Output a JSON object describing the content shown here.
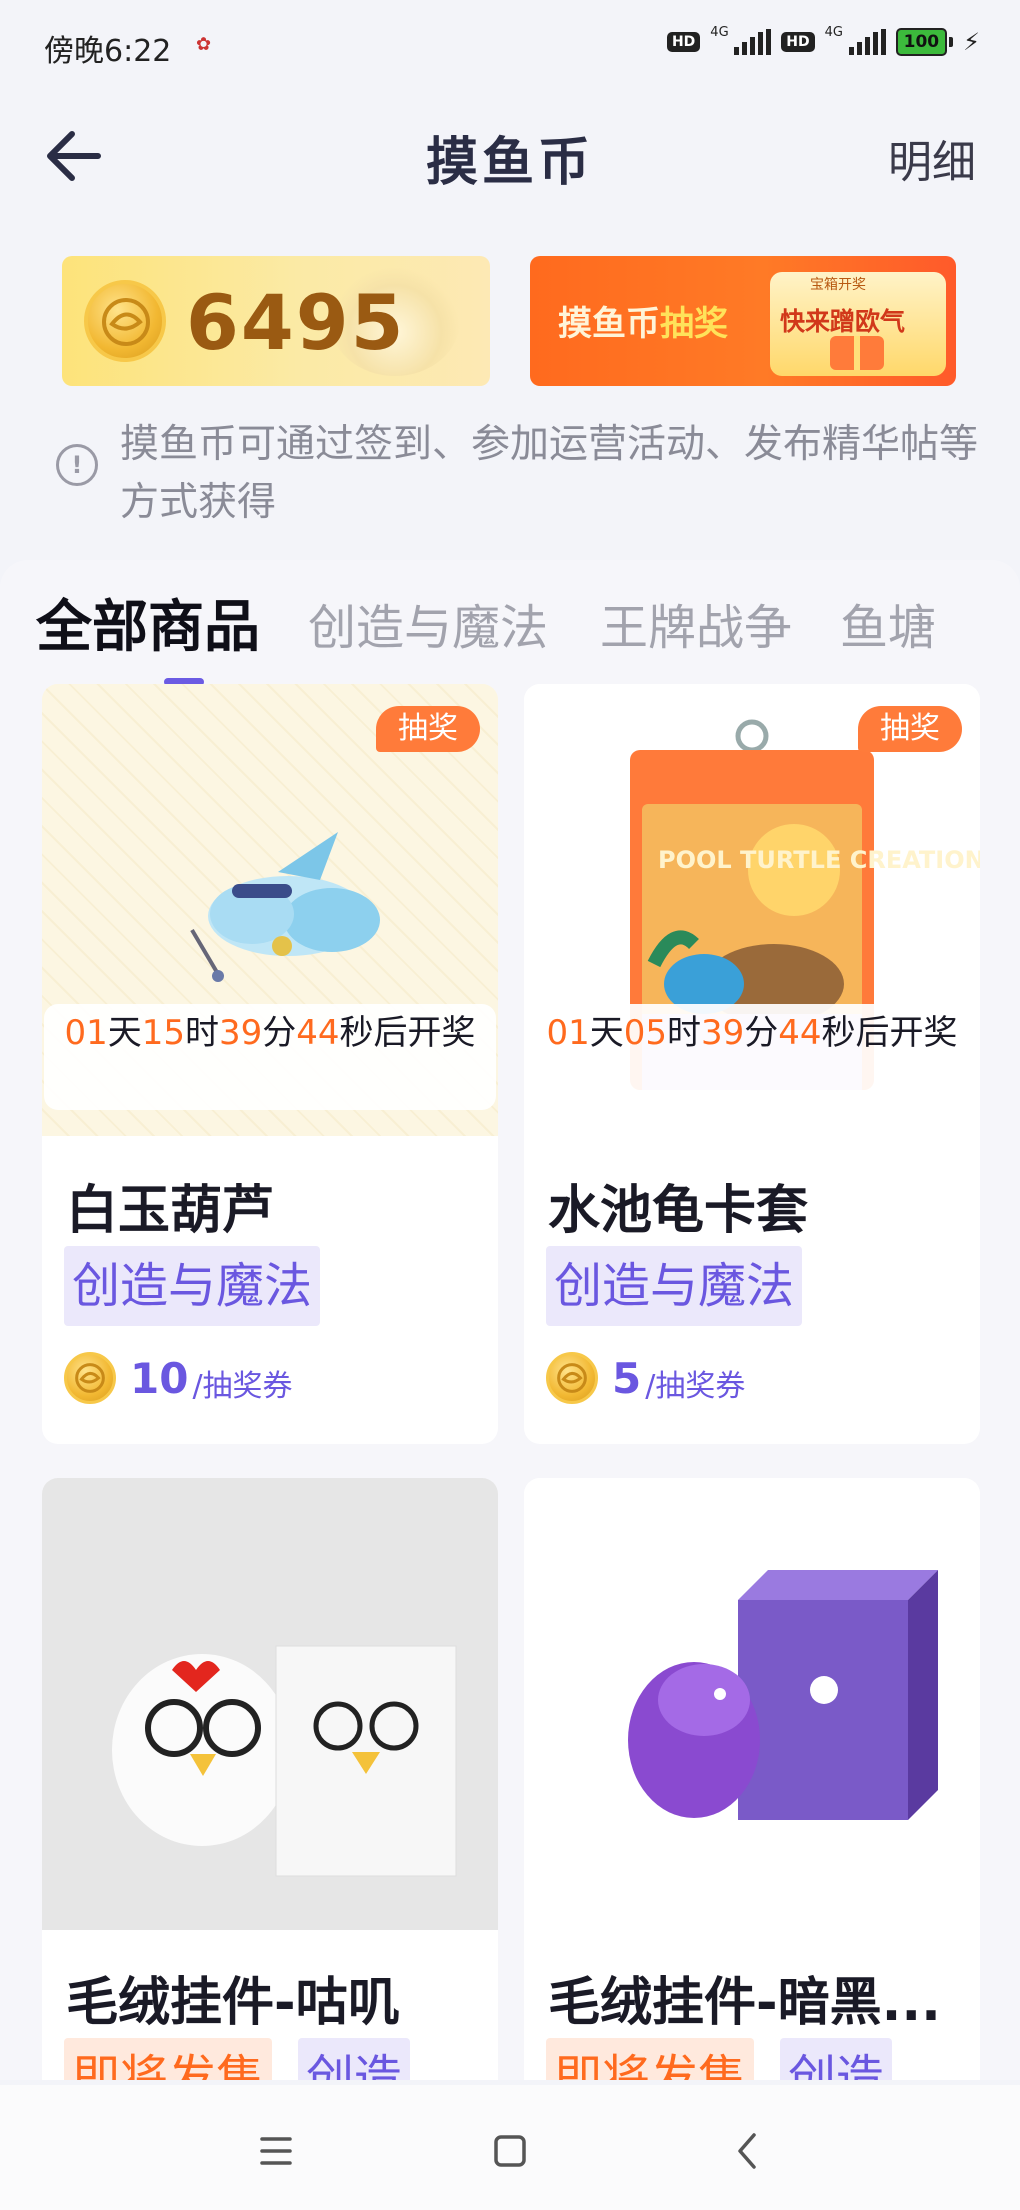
{
  "status_bar": {
    "time": "傍晚6:22",
    "hd1": "HD",
    "net1": "4G",
    "hd2": "HD",
    "net2": "4G",
    "battery": "100"
  },
  "header": {
    "title": "摸鱼币",
    "detail_label": "明细"
  },
  "balance": {
    "amount": "6495"
  },
  "lottery_banner": {
    "title_prefix": "摸鱼币",
    "title_highlight": "抽奖",
    "badge": "宝箱开奖",
    "cta": "快来蹭欧气"
  },
  "info": {
    "line1": "摸鱼币可通过签到、参加运营活动、发布精华帖等",
    "line2": "方式获得"
  },
  "tabs": [
    {
      "label": "全部商品",
      "active": true
    },
    {
      "label": "创造与魔法",
      "active": false
    },
    {
      "label": "王牌战争",
      "active": false
    },
    {
      "label": "鱼塘",
      "active": false
    }
  ],
  "products": [
    {
      "badge": "抽奖",
      "countdown": {
        "d": "01",
        "h": "15",
        "m": "39",
        "s": "44",
        "d_unit": "天",
        "h_unit": "时",
        "m_unit": "分",
        "s_unit": "秒后开奖"
      },
      "name": "白玉葫芦",
      "tag": "创造与魔法",
      "price": "10",
      "unit": "/抽奖券"
    },
    {
      "badge": "抽奖",
      "image_text": "POOL TURTLE CREATION",
      "countdown": {
        "d": "01",
        "h": "05",
        "m": "39",
        "s": "44",
        "d_unit": "天",
        "h_unit": "时",
        "m_unit": "分",
        "s_unit": "秒后开奖"
      },
      "name": "水池龟卡套",
      "tag": "创造与魔法",
      "price": "5",
      "unit": "/抽奖券"
    },
    {
      "name": "毛绒挂件-咕叽",
      "tag1": "即将发售",
      "tag2": "创造"
    },
    {
      "name": "毛绒挂件-暗黑...",
      "tag1": "即将发售",
      "tag2": "创造"
    }
  ],
  "colors": {
    "accent": "#6b5be3",
    "orange": "#ff6a1e",
    "coin_text": "#9a5a12"
  }
}
